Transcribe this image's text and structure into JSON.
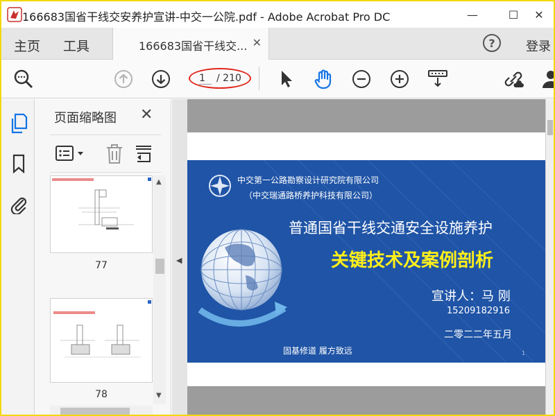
{
  "window": {
    "title": "166683国省干线交安养护宣讲-中交一公院.pdf - Adobe Acrobat Pro DC",
    "minimize": "—",
    "maximize": "☐",
    "close": "✕"
  },
  "menubar": {
    "home": "主页",
    "tools": "工具",
    "tab_label": "166683国省干线交...",
    "tab_close": "✕",
    "help": "?",
    "login": "登录"
  },
  "toolbar": {
    "page_current": "1",
    "page_total": "/ 210",
    "icons": [
      "search-zoom-icon",
      "page-up-icon",
      "page-down-icon",
      "select-cursor-icon",
      "hand-tool-icon",
      "zoom-out-icon",
      "zoom-in-icon",
      "scroll-mode-icon",
      "share-link-icon",
      "user-icon"
    ],
    "accent_color": "#e1261c"
  },
  "rail": {
    "icons": [
      "page-thumbnails-icon",
      "bookmark-icon",
      "attachment-icon"
    ],
    "active_color": "#1473e6"
  },
  "thumbnail_panel": {
    "title": "页面缩略图",
    "close": "✕",
    "thumbs": [
      {
        "page": "77"
      },
      {
        "page": "78"
      }
    ]
  },
  "slide": {
    "org_line1": "中交第一公路勘察设计研究院有限公司",
    "org_line2": "（中交瑞通路桥养护科技有限公司）",
    "title_line1": "普通国省干线交通安全设施养护",
    "title_line2": "关键技术及案例剖析",
    "speaker": "宣讲人：马 刚",
    "phone": "15209182916",
    "date": "二零二二年五月",
    "motto": "固基修道  履方致远",
    "page_number": "1",
    "background_color": "#1f54a6",
    "highlight_color": "#ffef1a"
  }
}
